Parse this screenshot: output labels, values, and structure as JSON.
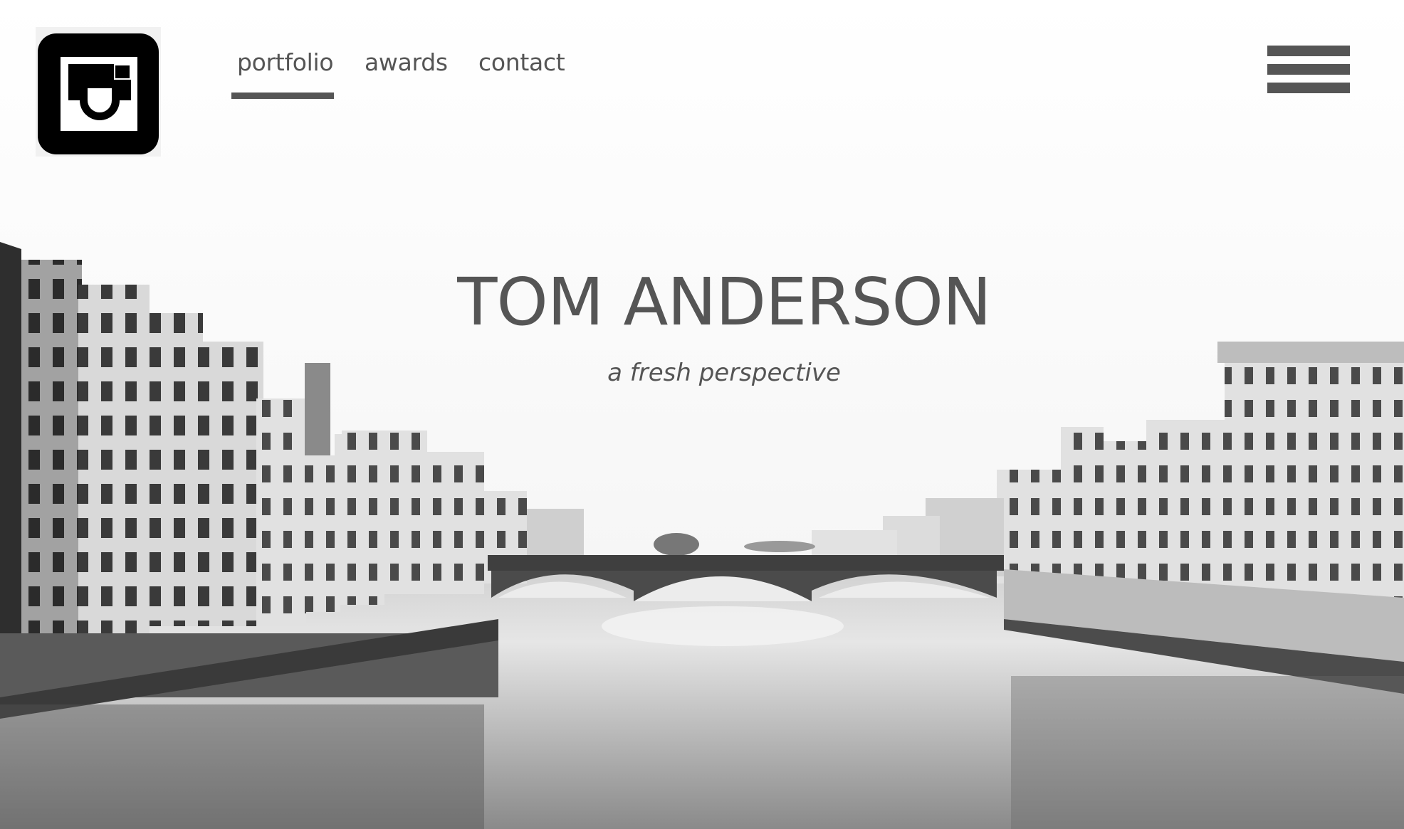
{
  "header": {
    "logo_icon": "camera-icon",
    "nav": [
      {
        "label": "portfolio",
        "active": true
      },
      {
        "label": "awards",
        "active": false
      },
      {
        "label": "contact",
        "active": false
      }
    ],
    "menu_icon": "hamburger-menu-icon"
  },
  "hero": {
    "title": "TOM ANDERSON",
    "tagline": "a fresh perspective",
    "image": "black-and-white river city bridge photo"
  },
  "colors": {
    "text": "#555555",
    "logo_bg": "#000000",
    "background": "#ffffff"
  }
}
